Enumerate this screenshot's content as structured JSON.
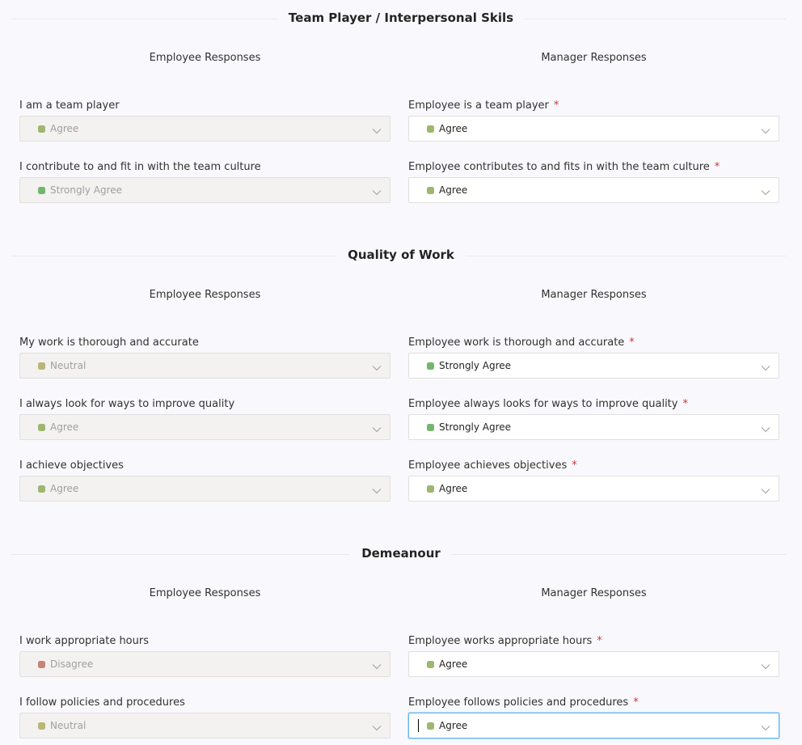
{
  "colors": {
    "strongly_agree": "#74b66e",
    "agree": "#9db76e",
    "neutral": "#b9b677",
    "disagree": "#c28876",
    "required": "#d13438",
    "focus": "#69b4f0"
  },
  "sections": [
    {
      "title": "Team Player / Interpersonal Skils",
      "employee_heading": "Employee Responses",
      "manager_heading": "Manager Responses",
      "rows": [
        {
          "employee": {
            "label": "I am a team player",
            "value": "Agree",
            "level": "agree"
          },
          "manager": {
            "label": "Employee is a team player",
            "required": "*",
            "value": "Agree",
            "level": "agree"
          }
        },
        {
          "employee": {
            "label": "I contribute to and fit in with the team culture",
            "value": "Strongly Agree",
            "level": "strongly_agree"
          },
          "manager": {
            "label": "Employee contributes to and fits in with the team culture",
            "required": "*",
            "value": "Agree",
            "level": "agree"
          }
        }
      ]
    },
    {
      "title": "Quality of Work",
      "employee_heading": "Employee Responses",
      "manager_heading": "Manager Responses",
      "rows": [
        {
          "employee": {
            "label": "My work is thorough and accurate",
            "value": "Neutral",
            "level": "neutral"
          },
          "manager": {
            "label": "Employee work is thorough and accurate",
            "required": "*",
            "value": "Strongly Agree",
            "level": "strongly_agree"
          }
        },
        {
          "employee": {
            "label": "I always look for ways to improve quality",
            "value": "Agree",
            "level": "agree"
          },
          "manager": {
            "label": "Employee always looks for ways to improve quality",
            "required": "*",
            "value": "Strongly Agree",
            "level": "strongly_agree"
          }
        },
        {
          "employee": {
            "label": "I achieve objectives",
            "value": "Agree",
            "level": "agree"
          },
          "manager": {
            "label": "Employee achieves objectives",
            "required": "*",
            "value": "Agree",
            "level": "agree"
          }
        }
      ]
    },
    {
      "title": "Demeanour",
      "employee_heading": "Employee Responses",
      "manager_heading": "Manager Responses",
      "rows": [
        {
          "employee": {
            "label": "I work appropriate hours",
            "value": "Disagree",
            "level": "disagree"
          },
          "manager": {
            "label": "Employee works appropriate hours",
            "required": "*",
            "value": "Agree",
            "level": "agree"
          }
        },
        {
          "employee": {
            "label": "I follow policies and procedures",
            "value": "Neutral",
            "level": "neutral"
          },
          "manager": {
            "label": "Employee follows policies and procedures",
            "required": "*",
            "value": "Agree",
            "level": "agree",
            "focused": true
          }
        }
      ]
    }
  ]
}
